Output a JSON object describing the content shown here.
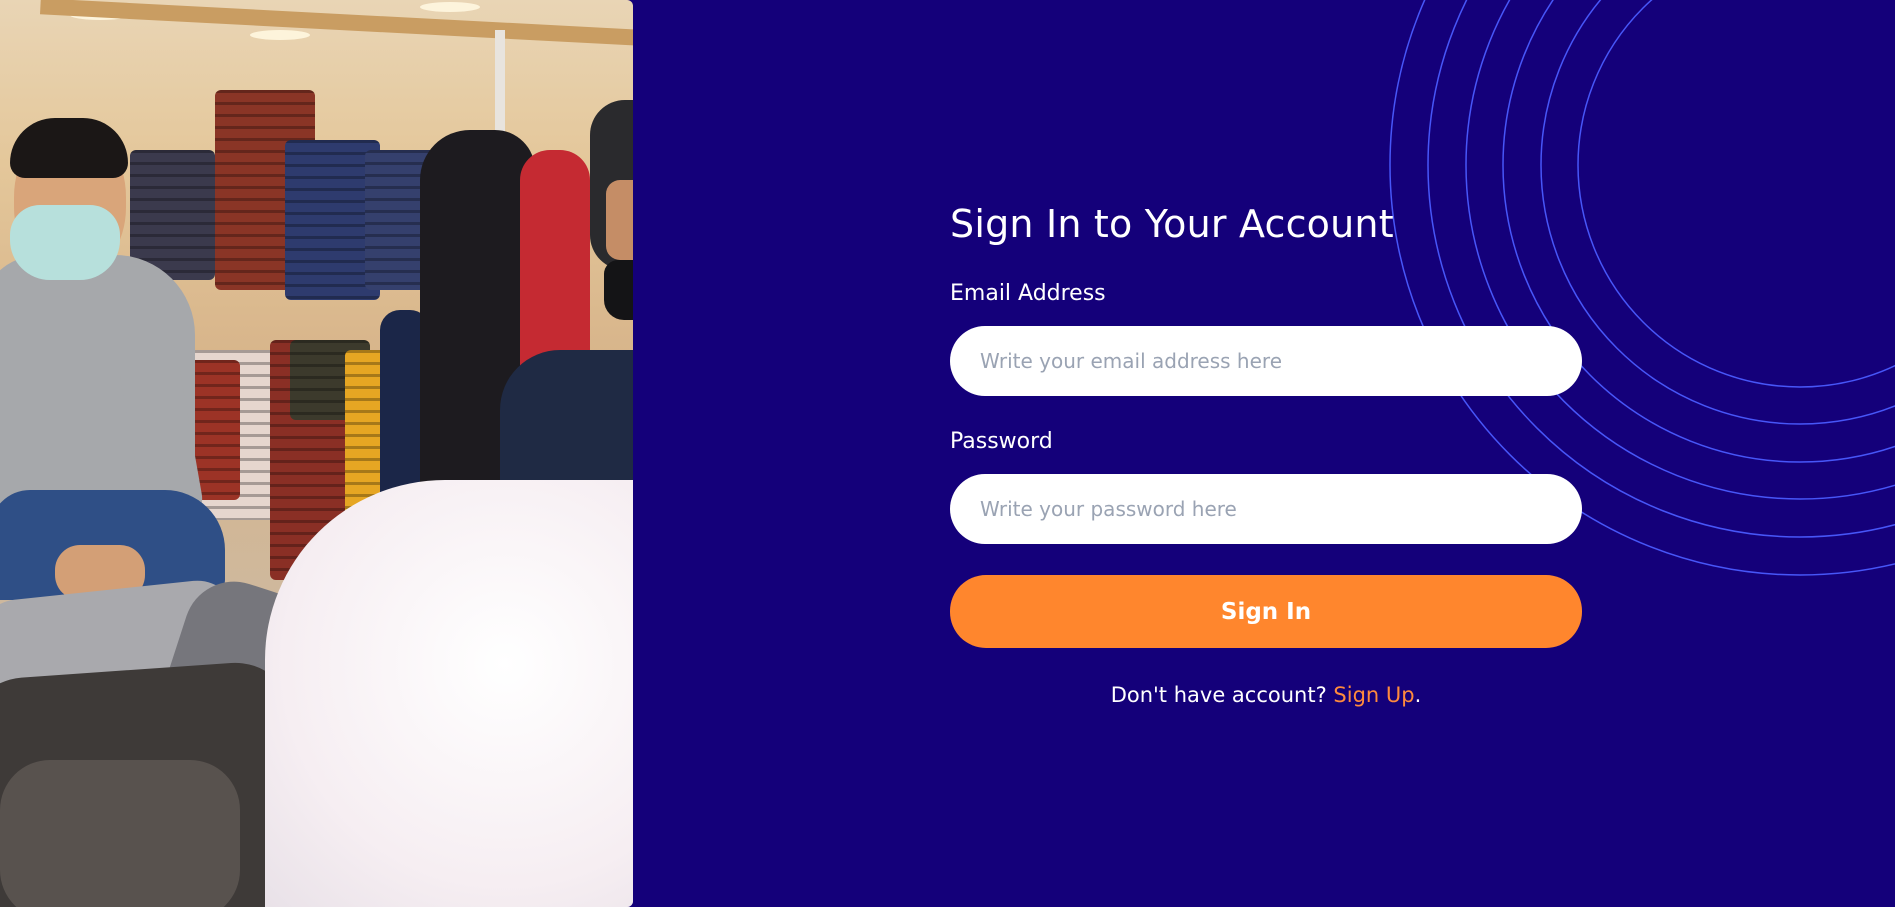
{
  "colors": {
    "background": "#14007a",
    "accent": "#ff862d",
    "link": "#ff8a3d",
    "arc": "#4a5bff"
  },
  "hero_image": {
    "icon": "store-photo"
  },
  "form": {
    "title": "Sign In to Your Account",
    "email": {
      "label": "Email Address",
      "placeholder": "Write your email address here",
      "value": ""
    },
    "password": {
      "label": "Password",
      "placeholder": "Write your password here",
      "value": ""
    },
    "submit_label": "Sign In",
    "signup_prompt": "Don't have account?",
    "signup_link": "Sign Up",
    "signup_suffix": "."
  }
}
